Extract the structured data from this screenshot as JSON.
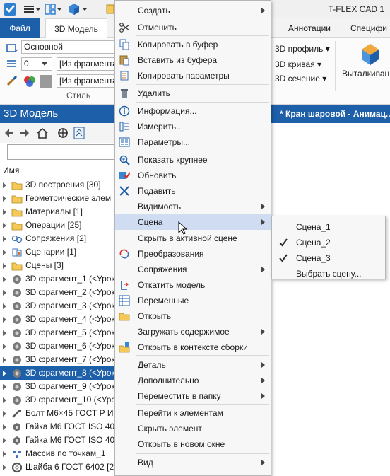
{
  "app": {
    "title": "T-FLEX CAD 1"
  },
  "ribbon": {
    "tabs": [
      {
        "label": "Файл"
      },
      {
        "label": "3D Модель"
      },
      {
        "label": "Аннотации"
      },
      {
        "label": "Специфи"
      }
    ],
    "style_group": {
      "layer_value": "Основной",
      "level_value": "0",
      "color_value": "[Из фрагмента",
      "material_value": "[Из фрагмента",
      "label": "Стиль"
    },
    "right_items": {
      "profile": "3D профиль",
      "curve": "3D кривая",
      "section": "3D сечение",
      "extrude": "Выталкиван"
    }
  },
  "panel": {
    "title": "3D Модель",
    "column_header": "Имя",
    "search_placeholder": "",
    "tree": [
      {
        "label": "3D построения [30]",
        "icon": "folder-icon"
      },
      {
        "label": "Геометрические элем",
        "icon": "folder-icon"
      },
      {
        "label": "Материалы [1]",
        "icon": "folder-icon"
      },
      {
        "label": "Операции [25]",
        "icon": "folder-icon"
      },
      {
        "label": "Сопряжения [2]",
        "icon": "mates-icon"
      },
      {
        "label": "Сценарии [1]",
        "icon": "scenario-icon"
      },
      {
        "label": "Сцены [3]",
        "icon": "folder-icon"
      },
      {
        "label": "3D фрагмент_1 (<Урок",
        "icon": "fragment-icon"
      },
      {
        "label": "3D фрагмент_2 (<Урок",
        "icon": "fragment-icon"
      },
      {
        "label": "3D фрагмент_3 (<Урок",
        "icon": "fragment-icon"
      },
      {
        "label": "3D фрагмент_4 (<Урок",
        "icon": "fragment-icon"
      },
      {
        "label": "3D фрагмент_5 (<Урок",
        "icon": "fragment-icon"
      },
      {
        "label": "3D фрагмент_6 (<Урок",
        "icon": "fragment-icon"
      },
      {
        "label": "3D фрагмент_7 (<Урок",
        "icon": "fragment-icon"
      },
      {
        "label": "3D фрагмент_8 (<Урок",
        "icon": "fragment-icon",
        "selected": true
      },
      {
        "label": "3D фрагмент_9 (<Урок",
        "icon": "fragment-icon"
      },
      {
        "label": "3D фрагмент_10 (<Урок",
        "icon": "fragment-icon"
      },
      {
        "label": "Болт М6×45 ГОСТ Р ИС",
        "icon": "bolt-icon"
      },
      {
        "label": "Гайка М6 ГОСТ ISO 403",
        "icon": "nut-icon"
      },
      {
        "label": "Гайка М6 ГОСТ ISO 403",
        "icon": "nut-icon"
      },
      {
        "label": "Массив по точкам_1",
        "icon": "array-icon"
      },
      {
        "label": "Шайба 6 ГОСТ 6402 [2]",
        "icon": "washer-icon"
      }
    ]
  },
  "document_tab": {
    "title": "* Кран шаровой - Анимац..."
  },
  "context_menu": {
    "items": [
      {
        "label": "Создать",
        "submenu": true
      },
      {
        "label": "Отменить",
        "icon": "scissors-icon"
      },
      {
        "label": "Копировать в буфер",
        "icon": "copy-icon"
      },
      {
        "label": "Вставить из буфера",
        "icon": "paste-icon"
      },
      {
        "label": "Копировать параметры",
        "icon": "copy-params-icon"
      },
      {
        "label": "Удалить",
        "icon": "trash-icon"
      },
      {
        "label": "Информация...",
        "icon": "info-icon"
      },
      {
        "label": "Измерить...",
        "icon": "measure-icon"
      },
      {
        "label": "Параметры...",
        "icon": "params-icon"
      },
      {
        "label": "Показать крупнее",
        "icon": "zoom-icon"
      },
      {
        "label": "Обновить",
        "icon": "update-icon"
      },
      {
        "label": "Подавить",
        "icon": "suppress-icon"
      },
      {
        "label": "Видимость",
        "submenu": true
      },
      {
        "label": "Сцена",
        "submenu": true,
        "highlighted": true
      },
      {
        "label": "Скрыть в активной сцене"
      },
      {
        "label": "Преобразования",
        "icon": "transform-icon"
      },
      {
        "label": "Сопряжения",
        "submenu": true
      },
      {
        "label": "Откатить модель",
        "icon": "rollback-icon"
      },
      {
        "label": "Переменные",
        "icon": "variables-icon"
      },
      {
        "label": "Открыть",
        "icon": "open-icon"
      },
      {
        "label": "Загружать содержимое",
        "submenu": true
      },
      {
        "label": "Открыть в контексте сборки",
        "icon": "open-context-icon"
      },
      {
        "label": "Деталь",
        "submenu": true
      },
      {
        "label": "Дополнительно",
        "submenu": true
      },
      {
        "label": "Переместить в папку",
        "submenu": true
      },
      {
        "label": "Перейти к элементам"
      },
      {
        "label": "Скрыть элемент"
      },
      {
        "label": "Открыть в новом окне"
      },
      {
        "label": "Вид",
        "submenu": true
      }
    ]
  },
  "scene_submenu": {
    "items": [
      {
        "label": "Сцена_1",
        "checked": false
      },
      {
        "label": "Сцена_2",
        "checked": true
      },
      {
        "label": "Сцена_3",
        "checked": true
      },
      {
        "label": "Выбрать сцену...",
        "checked": false
      }
    ]
  },
  "colors": {
    "accent": "#1d5fa8",
    "menu_highlight": "#cfdcf2",
    "folder": "#f5c85a"
  }
}
